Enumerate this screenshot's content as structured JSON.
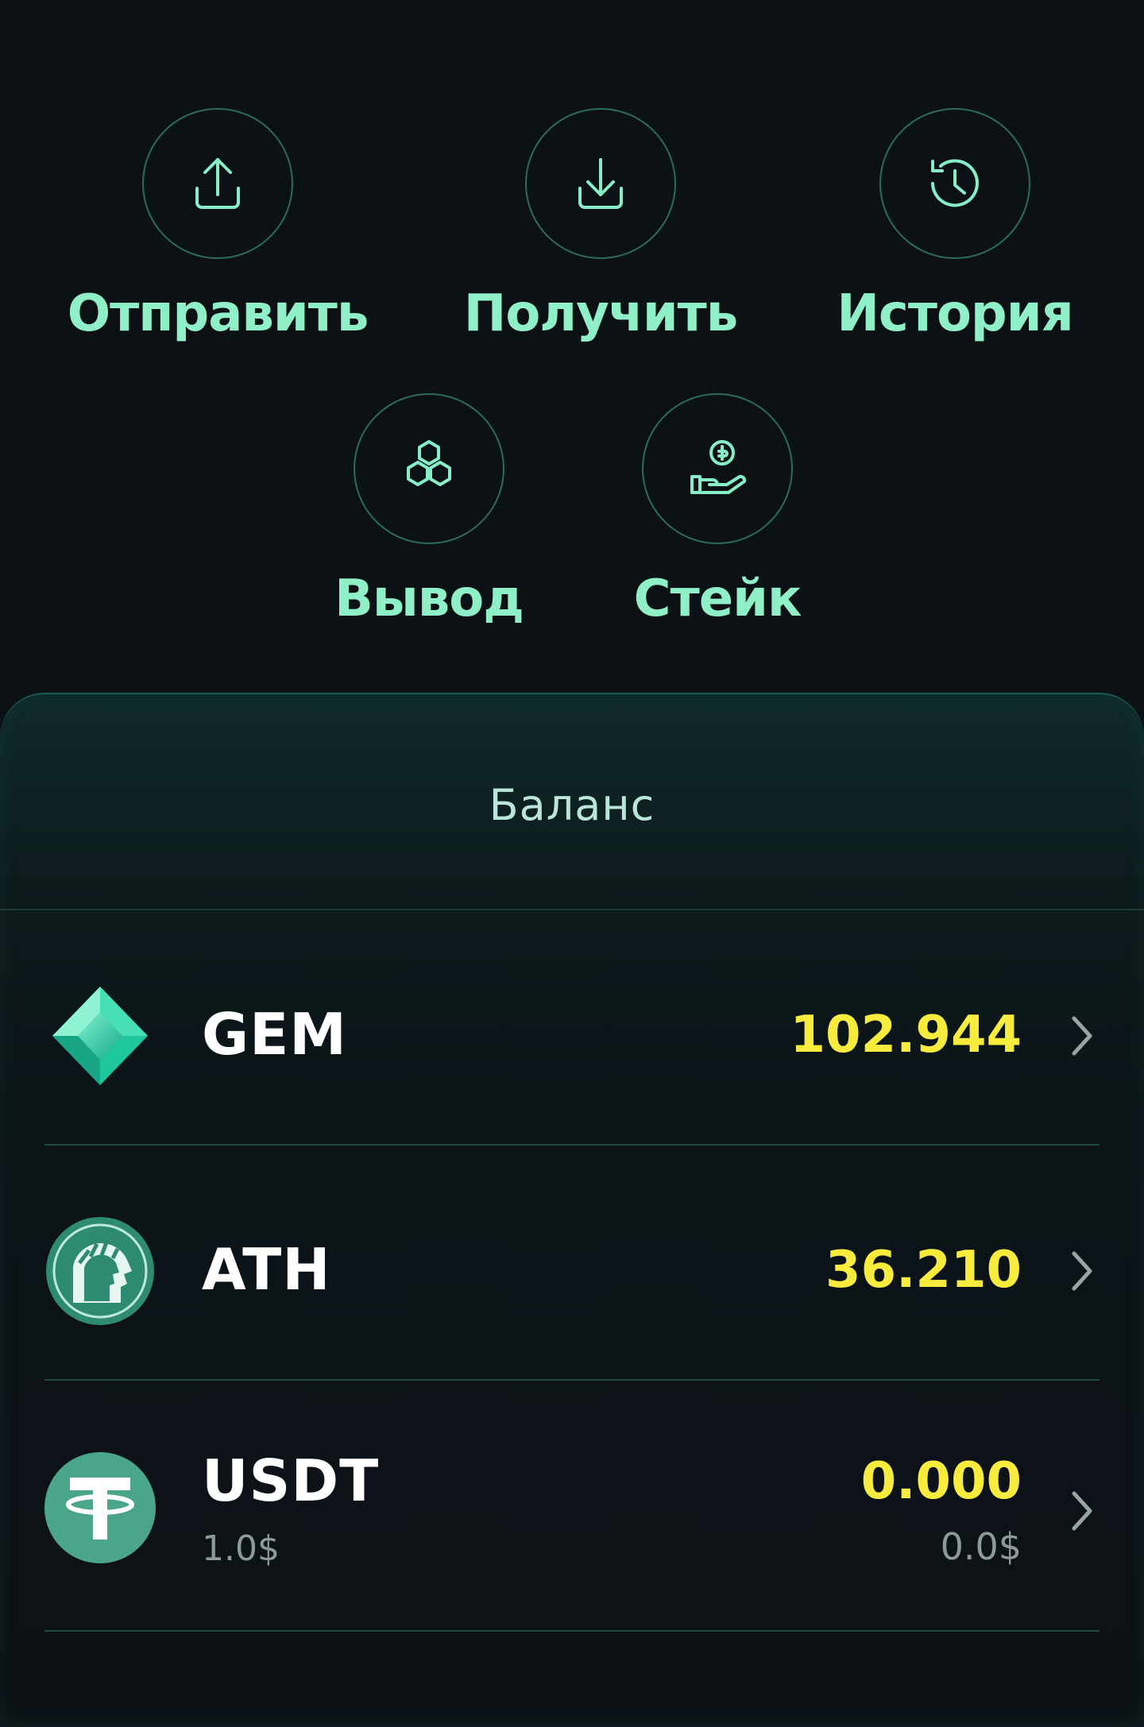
{
  "actions": [
    {
      "id": "send",
      "label": "Отправить",
      "icon": "upload-icon"
    },
    {
      "id": "receive",
      "label": "Получить",
      "icon": "download-icon"
    },
    {
      "id": "history",
      "label": "История",
      "icon": "history-icon"
    },
    {
      "id": "withdraw",
      "label": "Вывод",
      "icon": "hexagons-icon"
    },
    {
      "id": "stake",
      "label": "Стейк",
      "icon": "stake-hand-icon"
    }
  ],
  "balance": {
    "title": "Баланс",
    "assets": [
      {
        "symbol": "GEM",
        "amount": "102.944",
        "icon": "gem-diamond-icon"
      },
      {
        "symbol": "ATH",
        "amount": "36.210",
        "icon": "ath-helmet-icon"
      },
      {
        "symbol": "USDT",
        "price": "1.0$",
        "amount": "0.000",
        "value": "0.0$",
        "icon": "tether-icon"
      }
    ]
  },
  "colors": {
    "background": "#0c1116",
    "accent": "#8ff0c8",
    "amount": "#f7ec3d",
    "muted": "#8c9a99"
  }
}
